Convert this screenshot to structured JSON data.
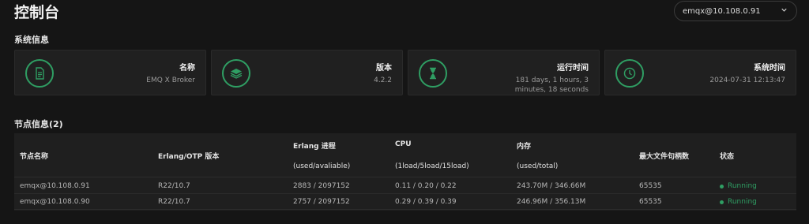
{
  "header": {
    "title": "控制台",
    "node_select_value": "emqx@10.108.0.91"
  },
  "system_info": {
    "section_title": "系统信息",
    "cards": [
      {
        "label": "名称",
        "value": "EMQ X Broker",
        "icon": "document-icon"
      },
      {
        "label": "版本",
        "value": "4.2.2",
        "icon": "layers-icon"
      },
      {
        "label": "运行时间",
        "value": "181 days, 1 hours, 3 minutes, 18 seconds",
        "icon": "hourglass-icon"
      },
      {
        "label": "系统时间",
        "value": "2024-07-31 12:13:47",
        "icon": "clock-icon"
      }
    ]
  },
  "node_info": {
    "section_title": "节点信息(2)",
    "columns": {
      "name": "节点名称",
      "erlang_otp": "Erlang/OTP 版本",
      "erlang_process": "Erlang 进程",
      "erlang_process_sub": "(used/avaliable)",
      "cpu": "CPU",
      "cpu_sub": "(1load/5load/15load)",
      "memory": "内存",
      "memory_sub": "(used/total)",
      "max_fd": "最大文件句柄数",
      "status": "状态"
    },
    "rows": [
      {
        "name": "emqx@10.108.0.91",
        "otp": "R22/10.7",
        "process": "2883 / 2097152",
        "cpu": "0.11 / 0.20 / 0.22",
        "memory": "243.70M / 346.66M",
        "max_fd": "65535",
        "status": "Running"
      },
      {
        "name": "emqx@10.108.0.90",
        "otp": "R22/10.7",
        "process": "2757 / 2097152",
        "cpu": "0.29 / 0.39 / 0.39",
        "memory": "246.96M / 356.13M",
        "max_fd": "65535",
        "status": "Running"
      }
    ]
  },
  "colors": {
    "accent": "#2f9e63",
    "background": "#151515",
    "card": "#202020"
  }
}
